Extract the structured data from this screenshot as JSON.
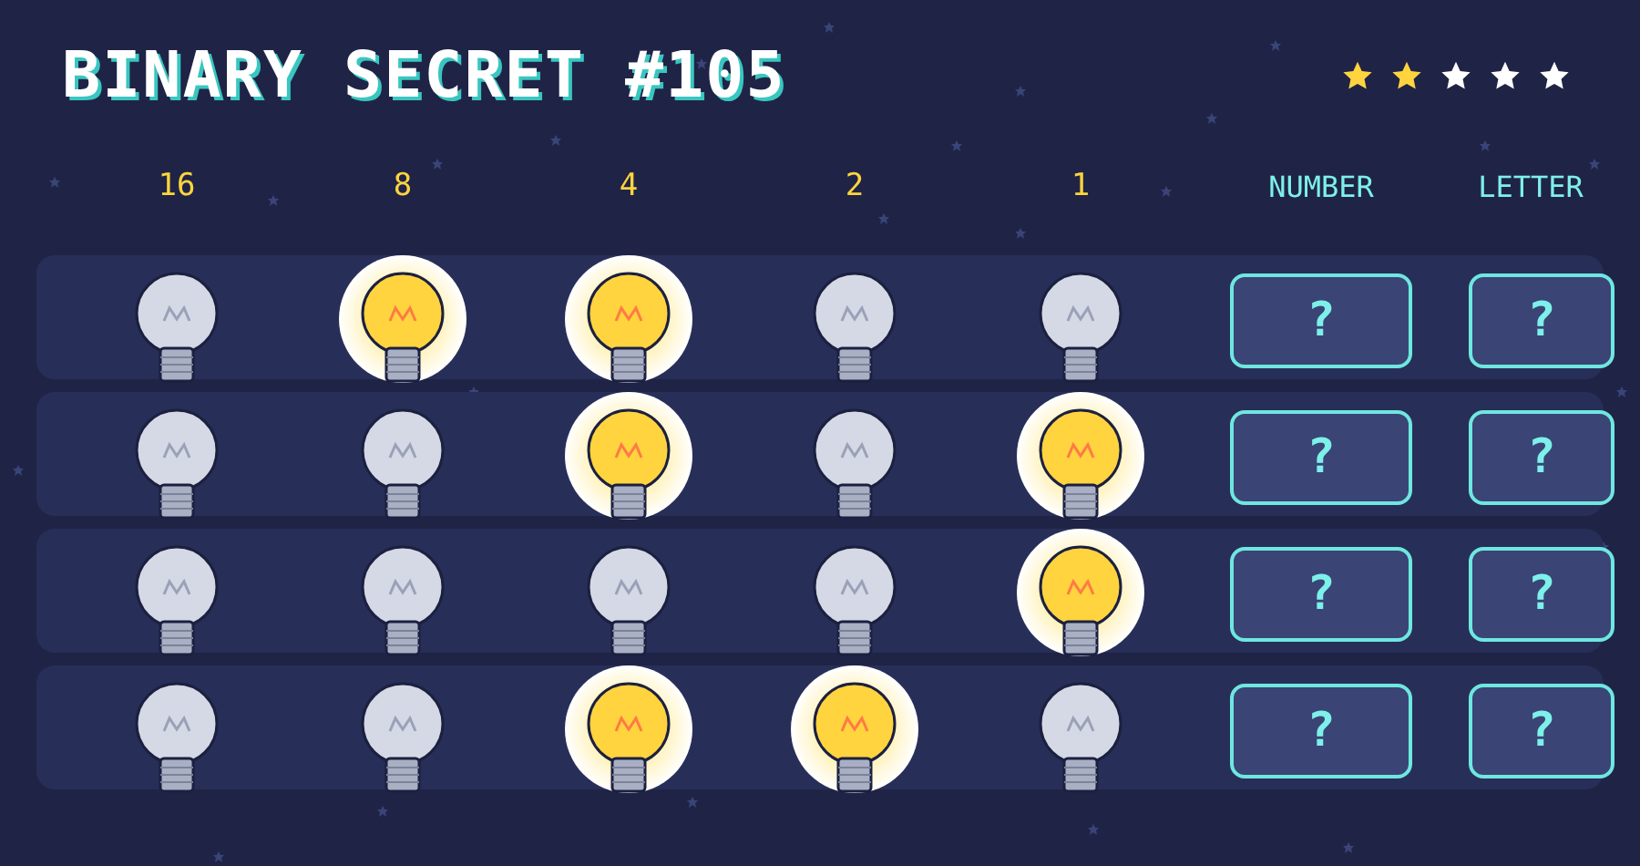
{
  "title": "BINARY SECRET #105",
  "rating": {
    "stars": 2
  },
  "columns": [
    "16",
    "8",
    "4",
    "2",
    "1",
    "NUMBER",
    "LETTER"
  ],
  "rows": [
    {
      "bulbs": [
        {
          "on": false
        },
        {
          "on": true
        },
        {
          "on": true
        },
        {
          "on": false
        },
        {
          "on": false
        }
      ],
      "number": "?",
      "letter": "?"
    },
    {
      "bulbs": [
        {
          "on": false
        },
        {
          "on": false
        },
        {
          "on": true
        },
        {
          "on": false
        },
        {
          "on": true
        }
      ],
      "number": "?",
      "letter": "?"
    },
    {
      "bulbs": [
        {
          "on": false
        },
        {
          "on": false
        },
        {
          "on": false
        },
        {
          "on": false
        },
        {
          "on": true
        }
      ],
      "number": "?",
      "letter": "?"
    },
    {
      "bulbs": [
        {
          "on": false
        },
        {
          "on": false
        },
        {
          "on": true
        },
        {
          "on": true
        },
        {
          "on": false
        }
      ],
      "number": "?",
      "letter": "?"
    }
  ]
}
